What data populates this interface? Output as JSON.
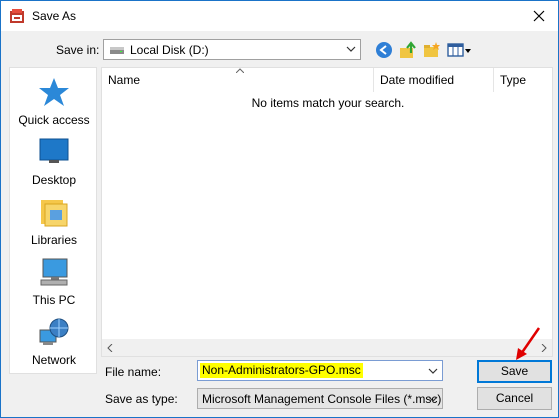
{
  "window": {
    "title": "Save As"
  },
  "save_in": {
    "label": "Save in:",
    "value": "Local Disk (D:)"
  },
  "toolbar": {
    "icons": [
      "back-icon",
      "up-folder-icon",
      "new-folder-icon",
      "view-menu-icon"
    ]
  },
  "places": [
    {
      "label": "Quick access",
      "icon": "quick-access-star-icon"
    },
    {
      "label": "Desktop",
      "icon": "desktop-icon"
    },
    {
      "label": "Libraries",
      "icon": "libraries-icon"
    },
    {
      "label": "This PC",
      "icon": "this-pc-icon"
    },
    {
      "label": "Network",
      "icon": "network-icon"
    }
  ],
  "file_list": {
    "columns": [
      "Name",
      "Date modified",
      "Type"
    ],
    "empty_message": "No items match your search."
  },
  "form": {
    "file_name_label": "File name:",
    "file_name_value": "Non-Administrators-GPO.msc",
    "save_type_label": "Save as type:",
    "save_type_value": "Microsoft Management Console Files (*.msc)"
  },
  "buttons": {
    "save": "Save",
    "cancel": "Cancel"
  },
  "colors": {
    "accent": "#0078d7",
    "highlight": "#ffff00",
    "annotation": "#e00000"
  }
}
